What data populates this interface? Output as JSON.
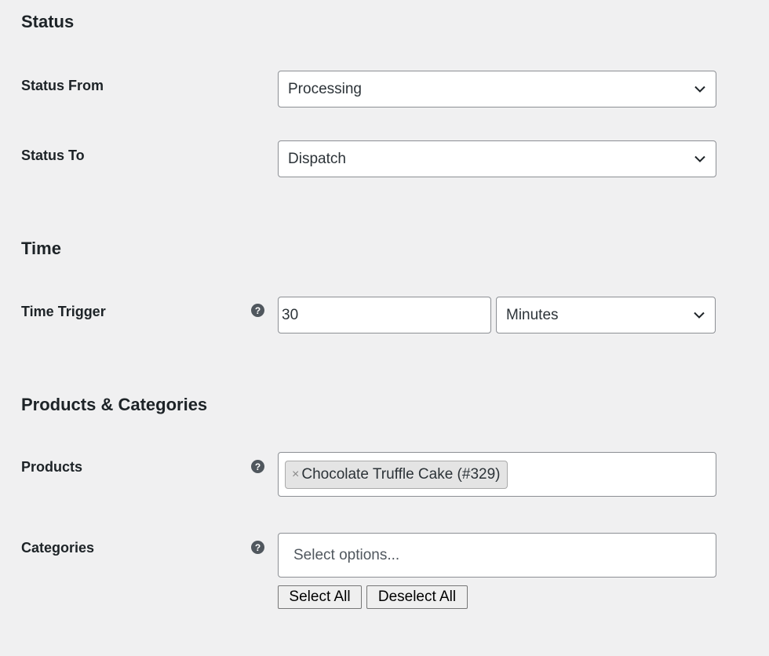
{
  "sections": {
    "status": {
      "heading": "Status",
      "status_from": {
        "label": "Status From",
        "value": "Processing",
        "icon": "chevron-down-icon"
      },
      "status_to": {
        "label": "Status To",
        "value": "Dispatch",
        "icon": "chevron-down-icon"
      }
    },
    "time": {
      "heading": "Time",
      "time_trigger": {
        "label": "Time Trigger",
        "help_icon": "?",
        "value": "30",
        "unit": "Minutes",
        "icon": "chevron-down-icon"
      }
    },
    "products_categories": {
      "heading": "Products & Categories",
      "products": {
        "label": "Products",
        "help_icon": "?",
        "selected": [
          {
            "remove": "×",
            "label": "Chocolate Truffle Cake (#329)"
          }
        ]
      },
      "categories": {
        "label": "Categories",
        "help_icon": "?",
        "placeholder": "Select options...",
        "select_all": "Select All",
        "deselect_all": "Deselect All"
      }
    }
  },
  "colors": {
    "page_background": "#f0f0f1",
    "text": "#1d2327",
    "border": "#8c8f94",
    "help_icon": "#50575e",
    "token_background": "#e4e4e4"
  }
}
